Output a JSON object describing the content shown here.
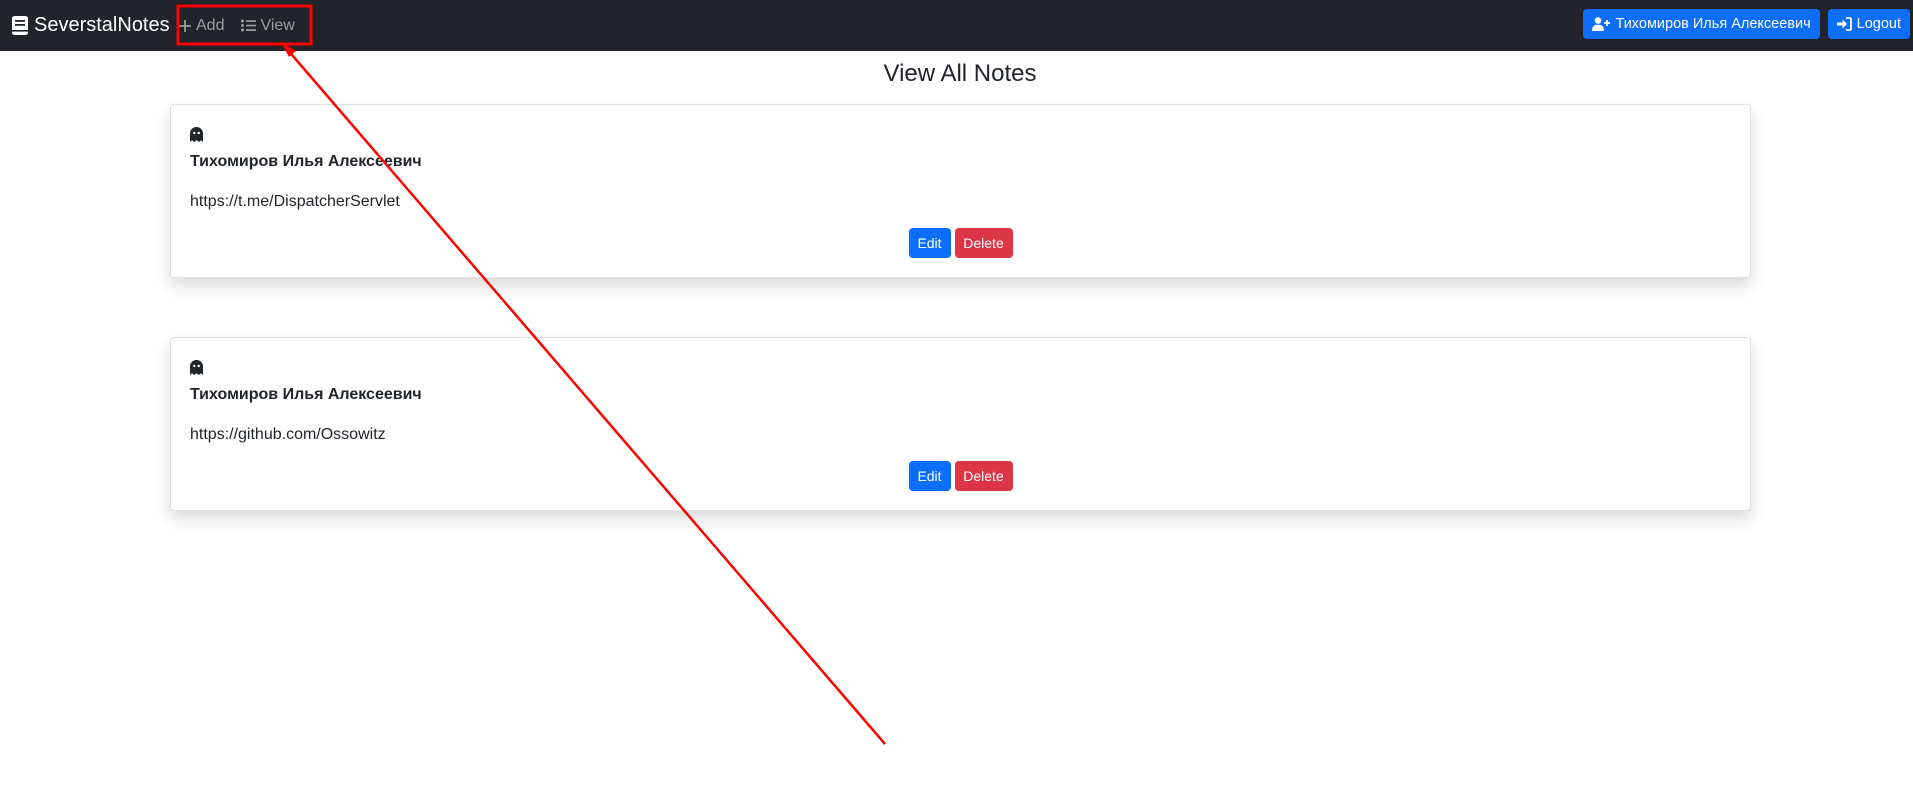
{
  "navbar": {
    "brand": "SeverstalNotes",
    "links": [
      {
        "label": "Add",
        "icon": "plus-icon"
      },
      {
        "label": "View",
        "icon": "list-icon"
      }
    ],
    "user_button": "Тихомиров Илья Алексеевич",
    "logout_button": "Logout"
  },
  "page": {
    "title": "View All Notes"
  },
  "notes": [
    {
      "icon": "ghost-icon",
      "author": "Тихомиров Илья Алексеевич",
      "text": "https://t.me/DispatcherServlet",
      "edit_label": "Edit",
      "delete_label": "Delete"
    },
    {
      "icon": "ghost-icon",
      "author": "Тихомиров Илья Алексеевич",
      "text": "https://github.com/Ossowitz",
      "edit_label": "Edit",
      "delete_label": "Delete"
    }
  ],
  "colors": {
    "navbar_bg": "#212529",
    "primary": "#0d6efd",
    "danger": "#dc3545",
    "annotation": "#ff0000"
  }
}
